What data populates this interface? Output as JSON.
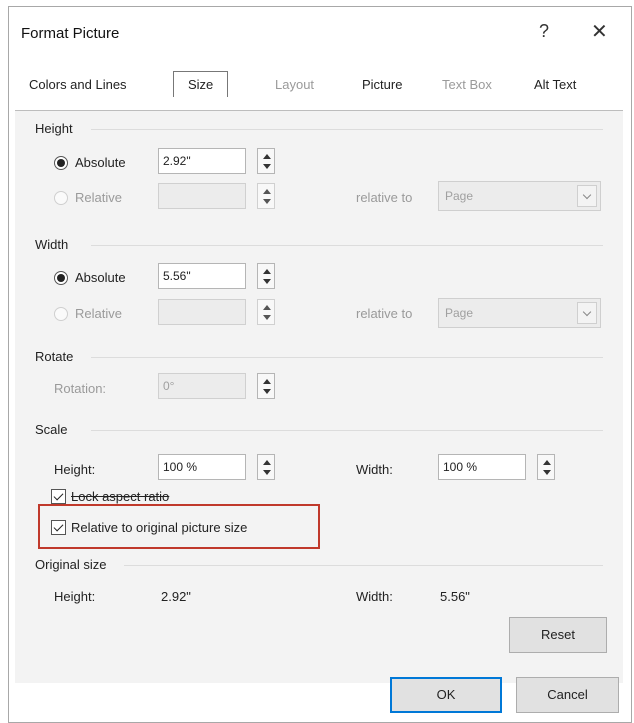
{
  "dialog": {
    "title": "Format Picture",
    "help": "?",
    "close": "✕"
  },
  "tabs": [
    "Colors and Lines",
    "Size",
    "Layout",
    "Picture",
    "Text Box",
    "Alt Text"
  ],
  "height": {
    "section": "Height",
    "absolute_label": "Absolute",
    "absolute_value": "2.92\"",
    "relative_label": "Relative",
    "relative_value": "",
    "relative_to_label": "relative to",
    "relative_to_value": "Page"
  },
  "width": {
    "section": "Width",
    "absolute_label": "Absolute",
    "absolute_value": "5.56\"",
    "relative_label": "Relative",
    "relative_value": "",
    "relative_to_label": "relative to",
    "relative_to_value": "Page"
  },
  "rotate": {
    "section": "Rotate",
    "rotation_label": "Rotation:",
    "rotation_value": "0°"
  },
  "scale": {
    "section": "Scale",
    "height_label": "Height:",
    "height_value": "100 %",
    "width_label": "Width:",
    "width_value": "100 %",
    "lock_aspect_label": "Lock aspect ratio",
    "relative_original_label": "Relative to original picture size"
  },
  "original_size": {
    "section": "Original size",
    "height_label": "Height:",
    "height_value": "2.92\"",
    "width_label": "Width:",
    "width_value": "5.56\""
  },
  "buttons": {
    "reset": "Reset",
    "ok": "OK",
    "cancel": "Cancel"
  },
  "colors": {
    "highlight": "#c0392b",
    "default_button_border": "#0078d7"
  }
}
